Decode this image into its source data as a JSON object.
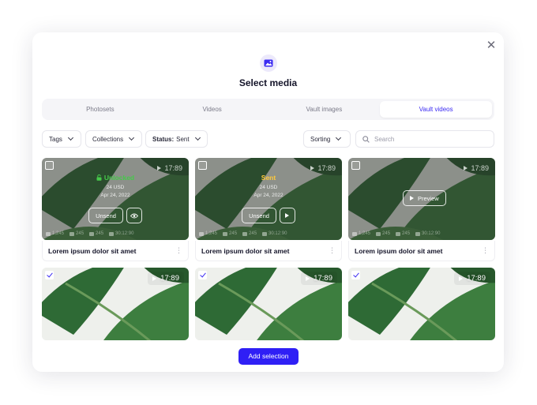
{
  "modal": {
    "title": "Select media",
    "close_icon": "close-icon",
    "header_icon": "media-icon"
  },
  "tabs": [
    {
      "label": "Photosets",
      "active": false
    },
    {
      "label": "Videos",
      "active": false
    },
    {
      "label": "Vault images",
      "active": false
    },
    {
      "label": "Vault videos",
      "active": true
    }
  ],
  "filters": {
    "tags": "Tags",
    "collections": "Collections",
    "status_label": "Status:",
    "status_value": "Sent",
    "sorting": "Sorting",
    "search_placeholder": "Search"
  },
  "cards": [
    {
      "duration": "17:89",
      "state": "Unlocked",
      "price": "24 USD",
      "date": "Apr 24, 2022",
      "action": "Unsend",
      "stats": [
        "1,245",
        "245",
        "245",
        "30:12:90"
      ],
      "title": "Lorem ipsum dolor sit amet",
      "checked": false
    },
    {
      "duration": "17:89",
      "state": "Sent",
      "price": "24 USD",
      "date": "Apr 24, 2022",
      "action": "Unsend",
      "stats": [
        "1,245",
        "245",
        "245",
        "30:12:90"
      ],
      "title": "Lorem ipsum dolor sit amet",
      "checked": false
    },
    {
      "duration": "17:89",
      "preview": "Preview",
      "stats": [
        "1,245",
        "245",
        "245",
        "30:12:90"
      ],
      "title": "Lorem ipsum dolor sit amet",
      "checked": false
    },
    {
      "duration": "17:89",
      "checked": true
    },
    {
      "duration": "17:89",
      "checked": true
    },
    {
      "duration": "17:89",
      "checked": true
    }
  ],
  "cta": {
    "label": "Add selection"
  },
  "colors": {
    "accent": "#2f1ff5",
    "unlocked": "#46c84a",
    "sent": "#ffc93a"
  }
}
